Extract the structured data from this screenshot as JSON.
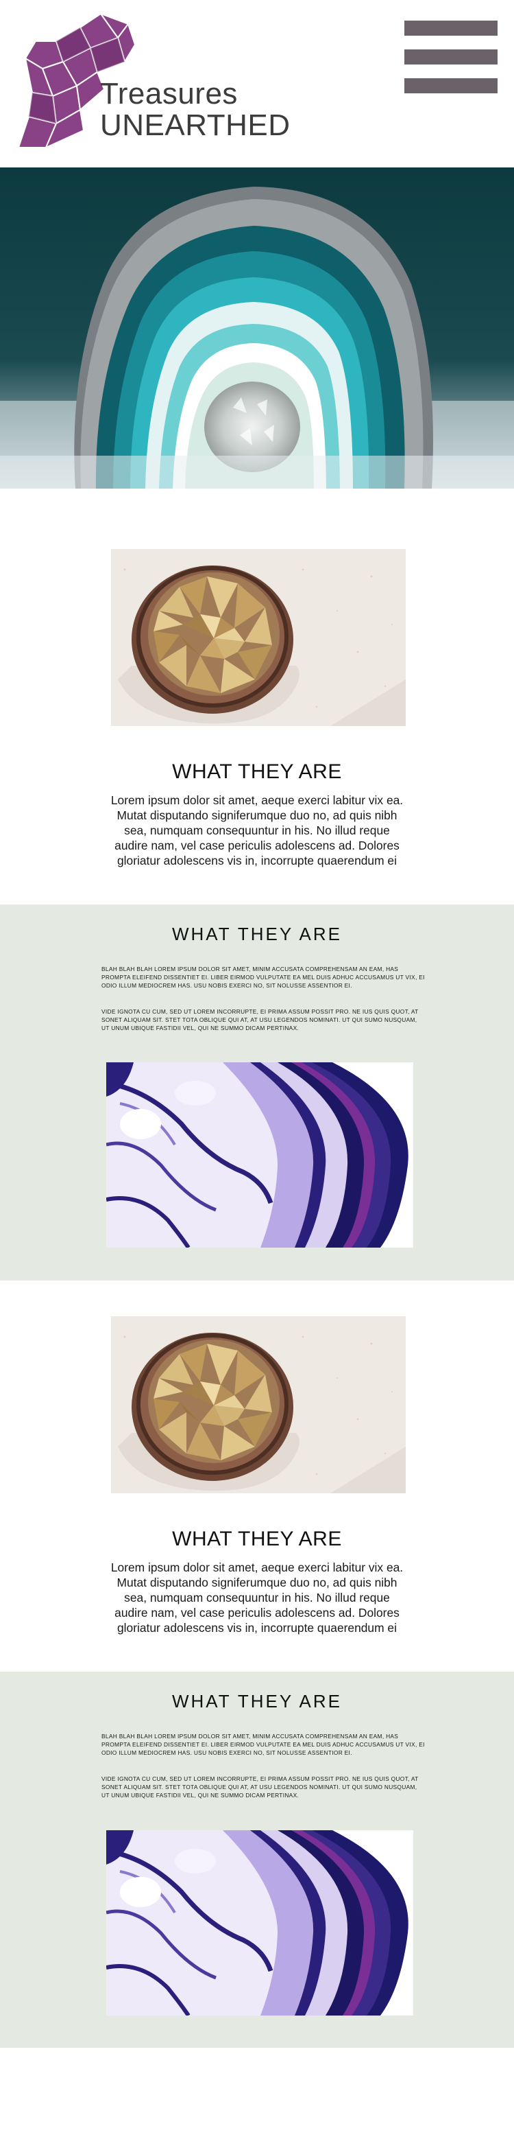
{
  "header": {
    "brand_line1": "Treasures",
    "brand_line2": "UNEARTHED",
    "logo_icon": "crystal-cluster-logo",
    "menu_icon": "hamburger-menu-icon"
  },
  "hero": {
    "image": "teal agate geode"
  },
  "sections": [
    {
      "title": "WHAT THEY ARE",
      "body": "Lorem ipsum dolor sit amet, aeque exerci labitur vix ea. Mutat disputando signiferumque duo no, ad quis nibh sea, numquam consequuntur in his. No illud reque audire nam, vel case periculis adolescens ad. Dolores gloriatur adolescens vis in, incorrupte quaerendum ei"
    },
    {
      "title": "WHAT THEY ARE",
      "para1": "Blah blah blah lorem ipsum dolor sit amet, minim accusata comprehensam an eam, has prompta eleifend dissentiet ei. Liber eirmod vulputate ea mel duis adhuc accusamus ut vix, ei odio illum mediocrem has. Usu nobis exerci no, sit nolusse assentior ei.",
      "para2": "Vide ignota cu cum, sed ut lorem incorrupte, ei prima assum possit pro. Ne ius quis quot, at sonet aliquam sit. Stet tota oblique qui at, at usu legendos nominati. Ut qui sumo nusquam, ut unum ubique fastidii vel, qui ne summo dicam pertinax."
    },
    {
      "title": "WHAT THEY ARE",
      "body": "Lorem ipsum dolor sit amet, aeque exerci labitur vix ea. Mutat disputando signiferumque duo no, ad quis nibh sea, numquam consequuntur in his. No illud reque audire nam, vel case periculis adolescens ad. Dolores gloriatur adolescens vis in, incorrupte quaerendum ei"
    },
    {
      "title": "WHAT THEY ARE",
      "para1": "Blah blah blah lorem ipsum dolor sit amet, minim accusata comprehensam an eam, has prompta eleifend dissentiet ei. Liber eirmod vulputate ea mel duis adhuc accusamus ut vix, ei odio illum mediocrem has. Usu nobis exerci no, sit nolusse assentior ei.",
      "para2": "Vide ignota cu cum, sed ut lorem incorrupte, ei prima assum possit pro. Ne ius quis quot, at sonet aliquam sit. Stet tota oblique qui at, at usu legendos nominati. Ut qui sumo nusquam, ut unum ubique fastidii vel, qui ne summo dicam pertinax."
    }
  ],
  "colors": {
    "menu_bar": "#6a6169",
    "logo_purple": "#7b3a78",
    "green_section": "#e4e9e1",
    "hero_teal": "#0e3a3e"
  }
}
